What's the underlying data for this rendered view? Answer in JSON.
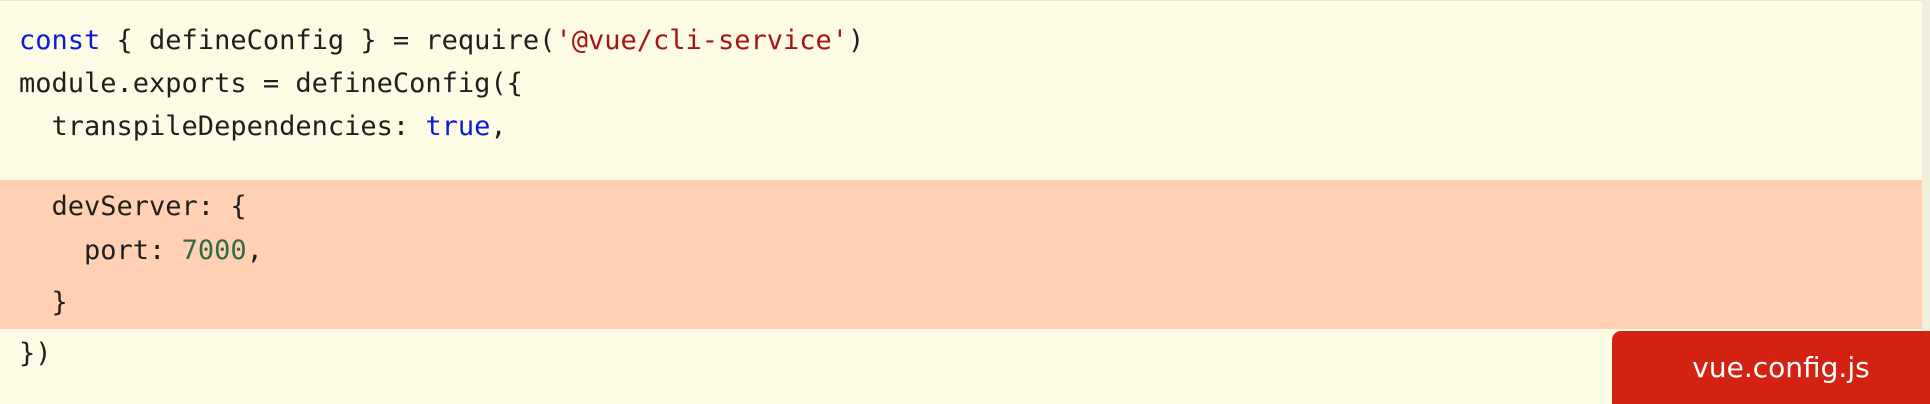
{
  "code": {
    "line1": {
      "kw": "const",
      "mid": " { defineConfig } = require(",
      "str": "'@vue/cli-service'",
      "end": ")"
    },
    "line2": "module.exports = defineConfig({",
    "line3": {
      "pre": "  transpileDependencies: ",
      "kw": "true",
      "post": ","
    },
    "line4": "  devServer: {",
    "line5": {
      "pre": "    port: ",
      "num": "7000",
      "post": ","
    },
    "line6": "  }",
    "line7": "})"
  },
  "filename_tag": "vue.config.js",
  "colors": {
    "background": "#fdfbe3",
    "highlight": "#ffd0b3",
    "keyword": "#0a1ad6",
    "string": "#a31515",
    "number": "#2f6b47",
    "tag": "#d32112"
  }
}
